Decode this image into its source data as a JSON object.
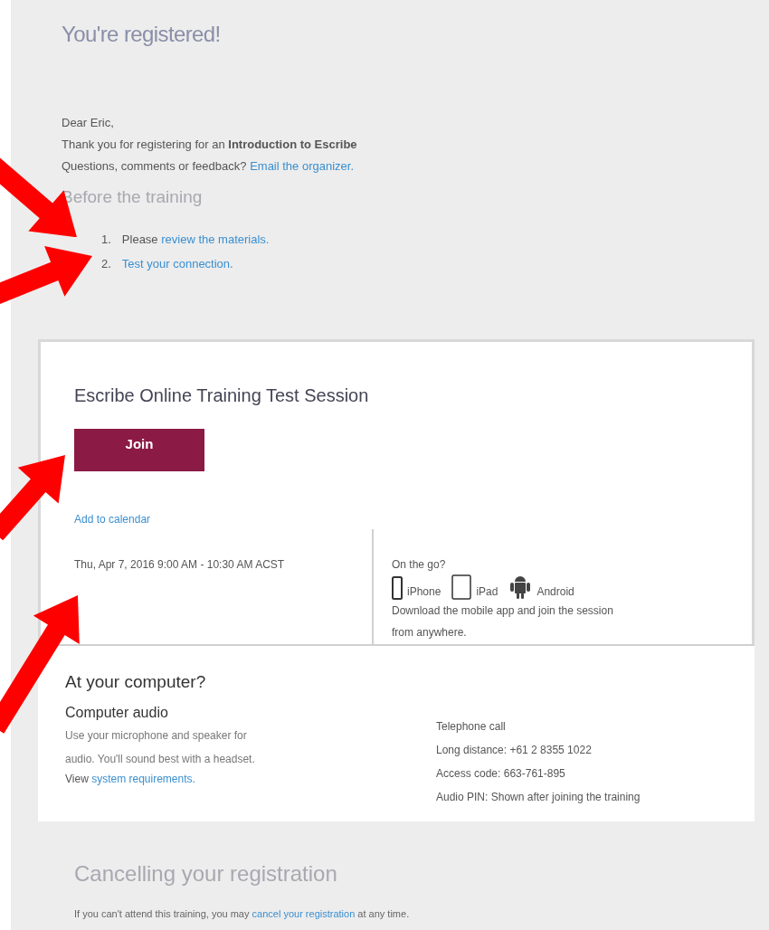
{
  "title": "You're registered!",
  "greeting": "Dear Eric,",
  "thanks": "Thank you for registering for an **Introduction to Escribe**",
  "questions": {
    "text": "Questions, comments or feedback?",
    "link": "Email the organizer."
  },
  "before": {
    "heading": "Before the training",
    "steps": [
      {
        "number": "1.",
        "text": "Please",
        "link": "review the materials."
      },
      {
        "number": "2.",
        "link": "Test your connection."
      }
    ]
  },
  "session": {
    "title": "Escribe Online Training Test Session",
    "join": "Join",
    "calendar": "Add to calendar",
    "datetime": "Thu, Apr 7, 2016 9:00 AM - 10:30 AM ACST",
    "mobile": {
      "heading": "On the go?",
      "devices": [
        {
          "kind": "phone",
          "label": "iPhone"
        },
        {
          "kind": "tablet",
          "label": "iPad"
        },
        {
          "kind": "android",
          "label": "Android"
        }
      ],
      "note": "Download the mobile app and join the session from anywhere."
    }
  },
  "computer": {
    "heading": "At your computer?",
    "audio_title": "Computer audio",
    "audio_text": "Use your microphone and speaker for audio. You'll sound best with a headset.",
    "view": "View",
    "requirements": "system requirements.",
    "phone": [
      "Telephone call",
      "Long distance: +61 2 8355 1022",
      "Access code: 663-761-895",
      "Audio PIN: Shown after joining the training"
    ]
  },
  "cancel": {
    "heading": "Cancelling your registration",
    "before": "If you can't attend this training, you may",
    "link": "cancel your registration",
    "after": "at any time."
  }
}
